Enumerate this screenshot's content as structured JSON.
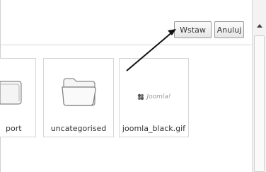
{
  "toolbar": {
    "insert_label": "Wstaw",
    "cancel_label": "Anuluj"
  },
  "media": {
    "items": [
      {
        "label": "port",
        "type": "folder"
      },
      {
        "label": "uncategorised",
        "type": "folder"
      },
      {
        "label": "joomla_black.gif",
        "type": "image"
      }
    ],
    "thumbnail_text": "Joomla!"
  },
  "icons": {
    "folder": "folder-icon",
    "image": "joomla-logo-thumbnail",
    "arrow": "annotation-arrow",
    "scroll_up": "chevron-up-icon"
  },
  "colors": {
    "arrow": "#111111",
    "button_border": "#9a9a9a"
  }
}
